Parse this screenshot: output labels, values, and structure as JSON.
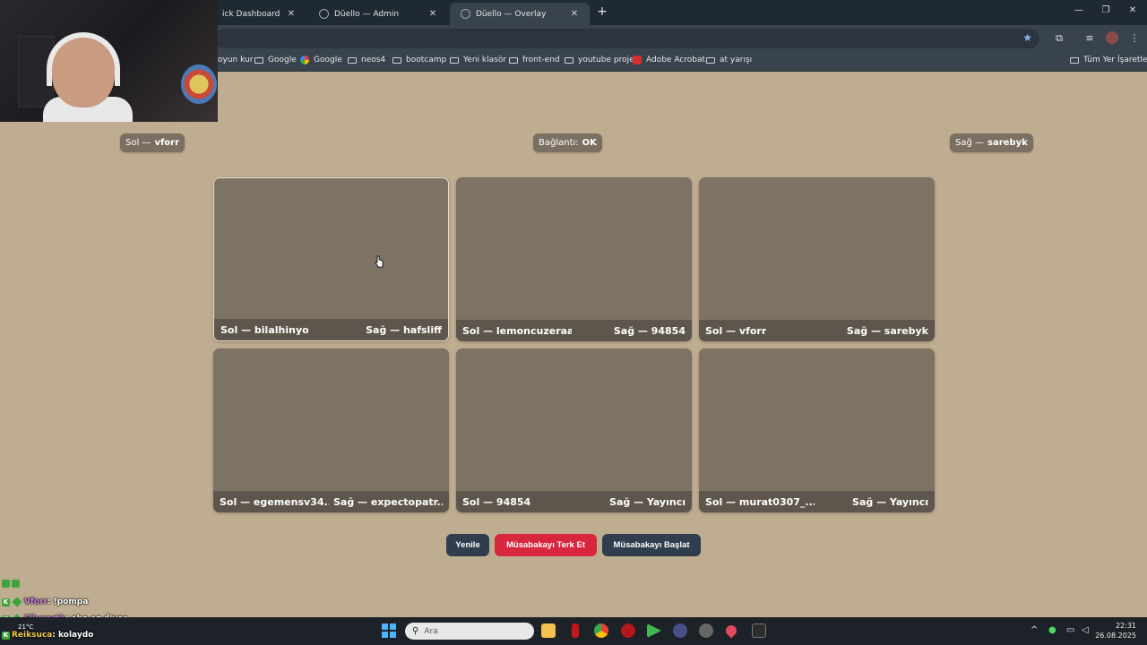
{
  "browser": {
    "tabs": [
      {
        "title": "ick Dashboard",
        "active": false
      },
      {
        "title": "Düello — Admin",
        "active": false
      },
      {
        "title": "Düello — Overlay",
        "active": true
      }
    ],
    "new_tab_symbol": "+",
    "bookmarks": [
      {
        "label": "oyun kur",
        "icon": "none"
      },
      {
        "label": "Google",
        "icon": "folder-icon"
      },
      {
        "label": "Google",
        "icon": "google-icon"
      },
      {
        "label": "neos4",
        "icon": "folder-icon"
      },
      {
        "label": "bootcamp",
        "icon": "folder-icon"
      },
      {
        "label": "Yeni klasör",
        "icon": "folder-icon"
      },
      {
        "label": "front-end",
        "icon": "folder-icon"
      },
      {
        "label": "youtube proje",
        "icon": "folder-icon"
      },
      {
        "label": "Adobe Acrobat",
        "icon": "pdf-icon"
      },
      {
        "label": "at yarışı",
        "icon": "folder-icon"
      }
    ],
    "all_bookmarks": "Tüm Yer İşaretleri"
  },
  "header": {
    "left": {
      "label": "Sol —",
      "value": "vforr"
    },
    "status": {
      "label": "Bağlantı:",
      "value": "OK"
    },
    "right": {
      "label": "Sağ —",
      "value": "sarebyk"
    }
  },
  "matches": [
    {
      "left": "Sol — bilalhinyo",
      "right": "Sağ — hafsliff"
    },
    {
      "left": "Sol — lemoncuzeraa",
      "right": "Sağ — 94854"
    },
    {
      "left": "Sol — vforr",
      "right": "Sağ — sarebyk"
    },
    {
      "left": "Sol — egemensv34...",
      "right": "Sağ — expectopatr..."
    },
    {
      "left": "Sol — 94854",
      "right": "Sağ — Yayıncı"
    },
    {
      "left": "Sol — murat0307_...",
      "right": "Sağ — Yayıncı"
    }
  ],
  "actions": {
    "refresh": "Yenile",
    "leave": "Müsabakayı Terk Et",
    "start": "Müsabakayı Başlat"
  },
  "chat": [
    {
      "user": "Vforr",
      "message": ": !pompa"
    },
    {
      "user": "Filuxarth",
      "message": ": oha ez diyor"
    },
    {
      "user": "Reiksuca",
      "message": ": kolaydo"
    }
  ],
  "taskbar": {
    "search_placeholder": "Ara",
    "weather": "21°C",
    "time": "22:31",
    "date": "26.08.2025"
  },
  "colors": {
    "page_bg": "#bfad91",
    "card_bg": "#7d7263",
    "card_footer": "#5e564c",
    "button_dark": "#2f3d4c",
    "button_red": "#d7263d"
  }
}
